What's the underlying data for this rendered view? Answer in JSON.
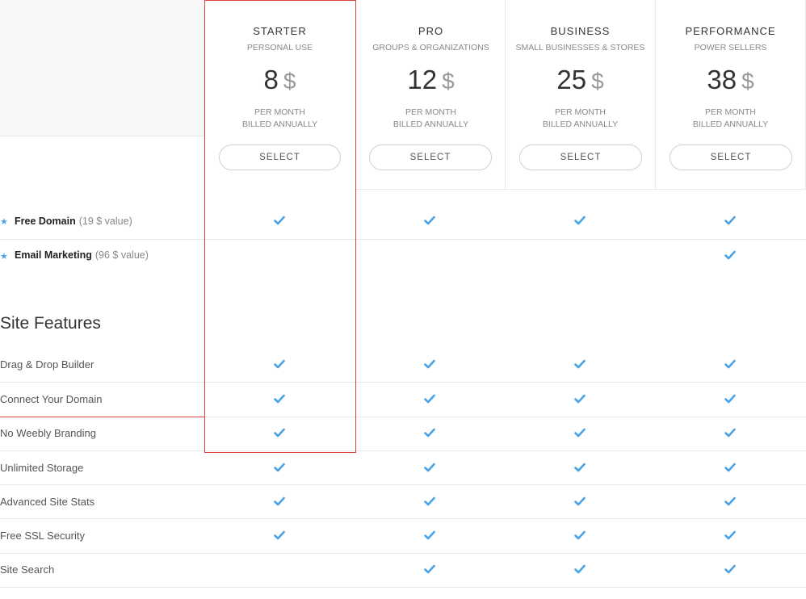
{
  "plans": [
    {
      "name": "STARTER",
      "subtitle": "PERSONAL USE",
      "price": "8",
      "currency": "$",
      "period1": "PER MONTH",
      "period2": "BILLED ANNUALLY",
      "button": "SELECT"
    },
    {
      "name": "PRO",
      "subtitle": "GROUPS & ORGANIZATIONS",
      "price": "12",
      "currency": "$",
      "period1": "PER MONTH",
      "period2": "BILLED ANNUALLY",
      "button": "SELECT"
    },
    {
      "name": "BUSINESS",
      "subtitle": "SMALL BUSINESSES & STORES",
      "price": "25",
      "currency": "$",
      "period1": "PER MONTH",
      "period2": "BILLED ANNUALLY",
      "button": "SELECT"
    },
    {
      "name": "PERFORMANCE",
      "subtitle": "POWER SELLERS",
      "price": "38",
      "currency": "$",
      "period1": "PER MONTH",
      "period2": "BILLED ANNUALLY",
      "button": "SELECT"
    }
  ],
  "bonus_features": [
    {
      "label": "Free Domain",
      "value": "(19 $ value)",
      "checks": [
        true,
        true,
        true,
        true
      ]
    },
    {
      "label": "Email Marketing",
      "value": "(96 $ value)",
      "checks": [
        false,
        false,
        false,
        true
      ]
    }
  ],
  "site_features": {
    "title": "Site Features",
    "rows": [
      {
        "label": "Drag & Drop Builder",
        "checks": [
          true,
          true,
          true,
          true
        ]
      },
      {
        "label": "Connect Your Domain",
        "checks": [
          true,
          true,
          true,
          true
        ]
      },
      {
        "label": "No Weebly Branding",
        "checks": [
          true,
          true,
          true,
          true
        ]
      },
      {
        "label": "Unlimited Storage",
        "checks": [
          true,
          true,
          true,
          true
        ]
      },
      {
        "label": "Advanced Site Stats",
        "checks": [
          true,
          true,
          true,
          true
        ]
      },
      {
        "label": "Free SSL Security",
        "checks": [
          true,
          true,
          true,
          true
        ]
      },
      {
        "label": "Site Search",
        "checks": [
          false,
          true,
          true,
          true
        ]
      }
    ]
  },
  "colors": {
    "accent": "#4aa3e6",
    "highlight": "#e3413d"
  }
}
